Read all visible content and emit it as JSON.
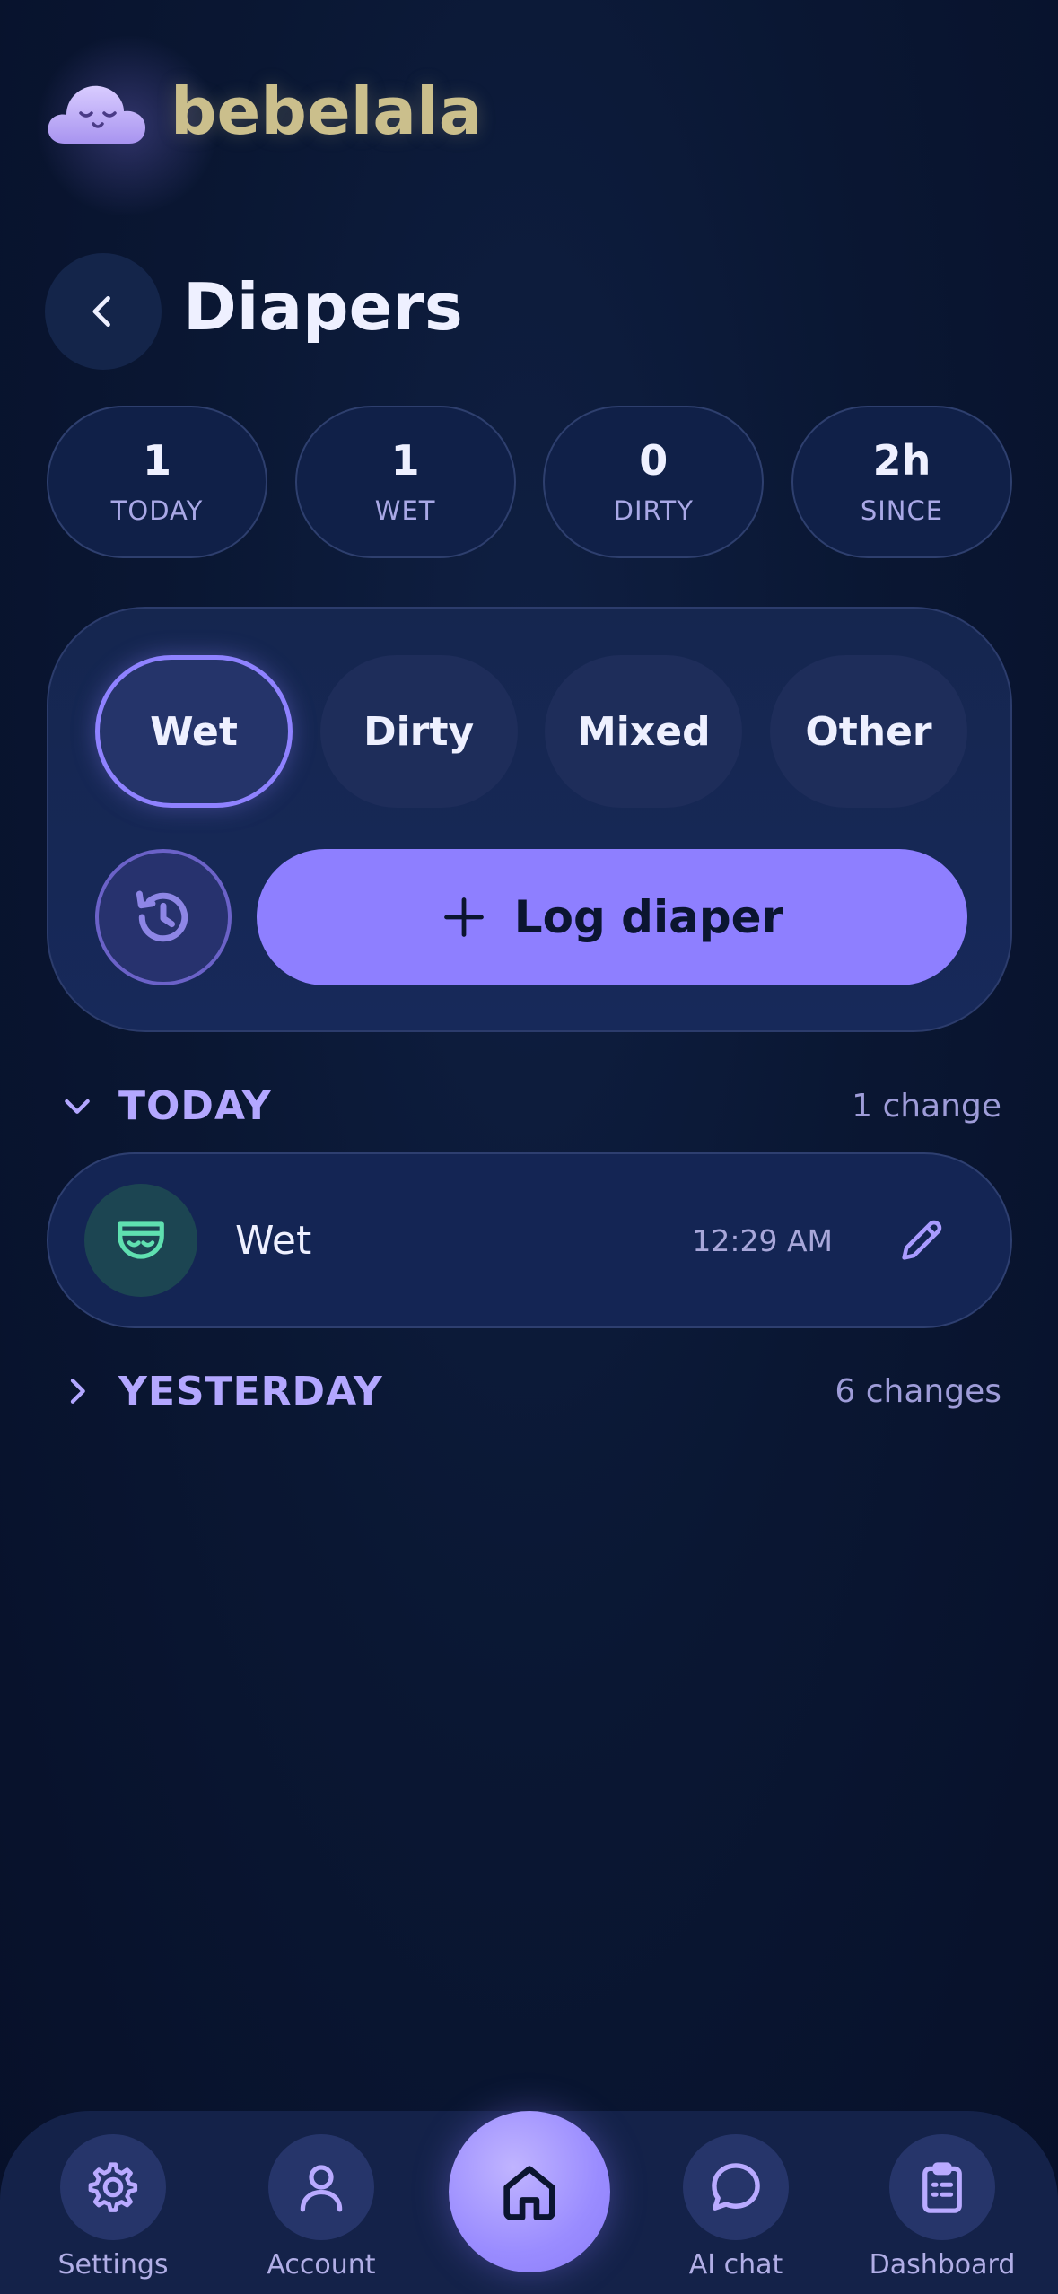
{
  "app": {
    "name": "bebelala"
  },
  "header": {
    "title": "Diapers"
  },
  "stats": [
    {
      "value": "1",
      "label": "TODAY"
    },
    {
      "value": "1",
      "label": "WET"
    },
    {
      "value": "0",
      "label": "DIRTY"
    },
    {
      "value": "2h",
      "label": "SINCE"
    }
  ],
  "types": [
    {
      "label": "Wet",
      "selected": true
    },
    {
      "label": "Dirty",
      "selected": false
    },
    {
      "label": "Mixed",
      "selected": false
    },
    {
      "label": "Other",
      "selected": false
    }
  ],
  "log_button": {
    "label": "Log diaper",
    "icon": "plus-icon"
  },
  "history_button": {
    "icon": "history-icon"
  },
  "sections": {
    "today": {
      "title": "TODAY",
      "count": "1 change",
      "expanded": true,
      "entries": [
        {
          "label": "Wet",
          "time": "12:29 AM",
          "icon": "diaper-icon"
        }
      ]
    },
    "yesterday": {
      "title": "YESTERDAY",
      "count": "6 changes",
      "expanded": false
    }
  },
  "nav": {
    "items": [
      {
        "label": "Settings",
        "icon": "gear-icon"
      },
      {
        "label": "Account",
        "icon": "user-icon"
      },
      {
        "label": "AI chat",
        "icon": "chat-bubble-icon"
      },
      {
        "label": "Dashboard",
        "icon": "clipboard-icon"
      }
    ],
    "home": {
      "icon": "home-icon"
    }
  },
  "colors": {
    "background": "#0a1733",
    "accent": "#8e7fff",
    "logo": "#cbbf8c",
    "section_title": "#b3a7ff",
    "entry_icon": "#5fe0b0"
  }
}
